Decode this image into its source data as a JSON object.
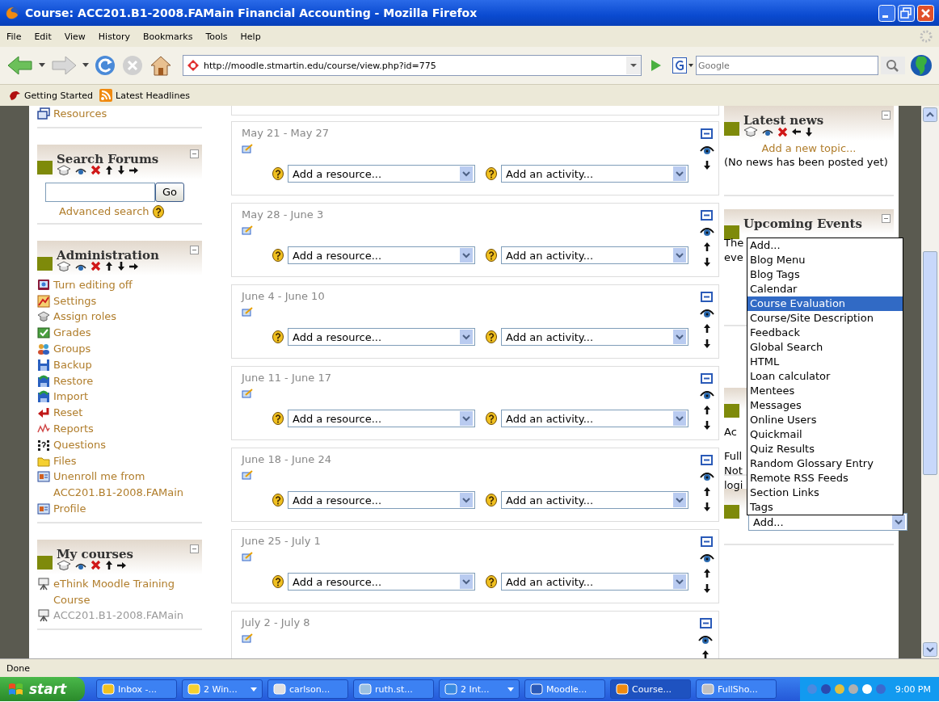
{
  "window": {
    "title": "Course: ACC201.B1-2008.FAMain Financial Accounting - Mozilla Firefox"
  },
  "menu": [
    "File",
    "Edit",
    "View",
    "History",
    "Bookmarks",
    "Tools",
    "Help"
  ],
  "address_bar": {
    "value": "http://moodle.stmartin.edu/course/view.php?id=775"
  },
  "search_bar": {
    "placeholder": "Google"
  },
  "bookmarks": [
    {
      "label": "Getting Started"
    },
    {
      "label": "Latest Headlines"
    }
  ],
  "left_blocks": [
    {
      "items": [
        {
          "label": "Resources"
        }
      ]
    },
    {
      "title": "Search Forums",
      "search": {
        "button": "Go",
        "link": "Advanced search"
      }
    },
    {
      "title": "Administration",
      "items": [
        {
          "label": "Turn editing off"
        },
        {
          "label": "Settings"
        },
        {
          "label": "Assign roles"
        },
        {
          "label": "Grades"
        },
        {
          "label": "Groups"
        },
        {
          "label": "Backup"
        },
        {
          "label": "Restore"
        },
        {
          "label": "Import"
        },
        {
          "label": "Reset"
        },
        {
          "label": "Reports"
        },
        {
          "label": "Questions"
        },
        {
          "label": "Files"
        },
        {
          "label": "Unenroll me from ACC201.B1-2008.FAMain"
        },
        {
          "label": "Profile"
        }
      ]
    },
    {
      "title": "My courses",
      "items": [
        {
          "label": "eThink Moodle Training Course",
          "dimmed": false
        },
        {
          "label": "ACC201.B1-2008.FAMain",
          "dimmed": true
        }
      ]
    }
  ],
  "sections": [
    {
      "dates": "May 21 - May 27",
      "up": false,
      "down": true,
      "resource_select": "Add a resource...",
      "activity_select": "Add an activity..."
    },
    {
      "dates": "May 28 - June 3",
      "up": true,
      "down": true,
      "resource_select": "Add a resource...",
      "activity_select": "Add an activity..."
    },
    {
      "dates": "June 4 - June 10",
      "up": true,
      "down": true,
      "resource_select": "Add a resource...",
      "activity_select": "Add an activity..."
    },
    {
      "dates": "June 11 - June 17",
      "up": true,
      "down": true,
      "resource_select": "Add a resource...",
      "activity_select": "Add an activity..."
    },
    {
      "dates": "June 18 - June 24",
      "up": true,
      "down": true,
      "resource_select": "Add a resource...",
      "activity_select": "Add an activity..."
    },
    {
      "dates": "June 25 - July 1",
      "up": true,
      "down": true,
      "resource_select": "Add a resource...",
      "activity_select": "Add an activity..."
    },
    {
      "dates": "July 2 - July 8",
      "up": true,
      "down": false
    }
  ],
  "right_blocks": [
    {
      "title": "Latest news",
      "link": "Add a new topic...",
      "lines": [
        "(No news has been posted yet)"
      ]
    },
    {
      "title": "Upcoming Events",
      "lines": [
        "The",
        "eve"
      ]
    },
    {
      "lines": [
        "Ac",
        "Full",
        "Not",
        "logi"
      ]
    },
    {
      "add_select": "Add..."
    }
  ],
  "block_menu": {
    "options": [
      {
        "label": "Add...",
        "selected": false
      },
      {
        "label": "Blog Menu",
        "selected": false
      },
      {
        "label": "Blog Tags",
        "selected": false
      },
      {
        "label": "Calendar",
        "selected": false
      },
      {
        "label": "Course Evaluation",
        "selected": true
      },
      {
        "label": "Course/Site Description",
        "selected": false
      },
      {
        "label": "Feedback",
        "selected": false
      },
      {
        "label": "Global Search",
        "selected": false
      },
      {
        "label": "HTML",
        "selected": false
      },
      {
        "label": "Loan calculator",
        "selected": false
      },
      {
        "label": "Mentees",
        "selected": false
      },
      {
        "label": "Messages",
        "selected": false
      },
      {
        "label": "Online Users",
        "selected": false
      },
      {
        "label": "Quickmail",
        "selected": false
      },
      {
        "label": "Quiz Results",
        "selected": false
      },
      {
        "label": "Random Glossary Entry",
        "selected": false
      },
      {
        "label": "Remote RSS Feeds",
        "selected": false
      },
      {
        "label": "Section Links",
        "selected": false
      },
      {
        "label": "Tags",
        "selected": false
      }
    ]
  },
  "status_bar": "Done",
  "taskbar": {
    "start": "start",
    "tasks": [
      {
        "label": "Inbox -...",
        "group": false,
        "active": false
      },
      {
        "label": "2 Win...",
        "group": true,
        "active": false
      },
      {
        "label": "carlson...",
        "group": false,
        "active": false
      },
      {
        "label": "ruth.st...",
        "group": false,
        "active": false
      },
      {
        "label": "2 Int...",
        "group": true,
        "active": false
      },
      {
        "label": "Moodle...",
        "group": false,
        "active": false
      },
      {
        "label": "Course...",
        "group": false,
        "active": true
      },
      {
        "label": "FullSho...",
        "group": false,
        "active": false
      }
    ],
    "clock": "9:00 PM"
  }
}
